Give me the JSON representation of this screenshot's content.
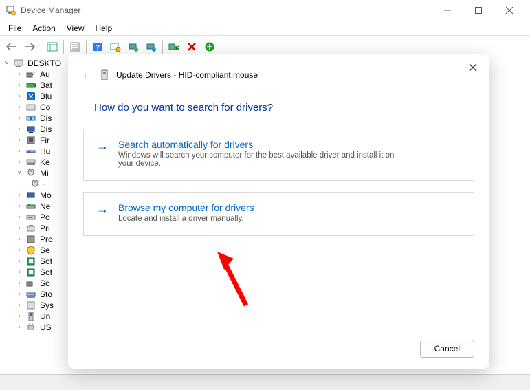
{
  "window": {
    "title": "Device Manager"
  },
  "menu": {
    "file": "File",
    "action": "Action",
    "view": "View",
    "help": "Help"
  },
  "tree": {
    "root": "DESKTO",
    "items": [
      "Au",
      "Bat",
      "Blu",
      "Co",
      "Dis",
      "Dis",
      "Fir",
      "Hu",
      "Ke",
      "Mi",
      "",
      "Mo",
      "Ne",
      "Po",
      "Pri",
      "Pro",
      "Se",
      "Sof",
      "Sof",
      "So",
      "Sto",
      "Sys",
      "Un",
      "US"
    ]
  },
  "dialog": {
    "title": "Update Drivers - HID-compliant mouse",
    "question": "How do you want to search for drivers?",
    "opt1": {
      "title": "Search automatically for drivers",
      "desc": "Windows will search your computer for the best available driver and install it on your device."
    },
    "opt2": {
      "title": "Browse my computer for drivers",
      "desc": "Locate and install a driver manually."
    },
    "cancel": "Cancel"
  }
}
